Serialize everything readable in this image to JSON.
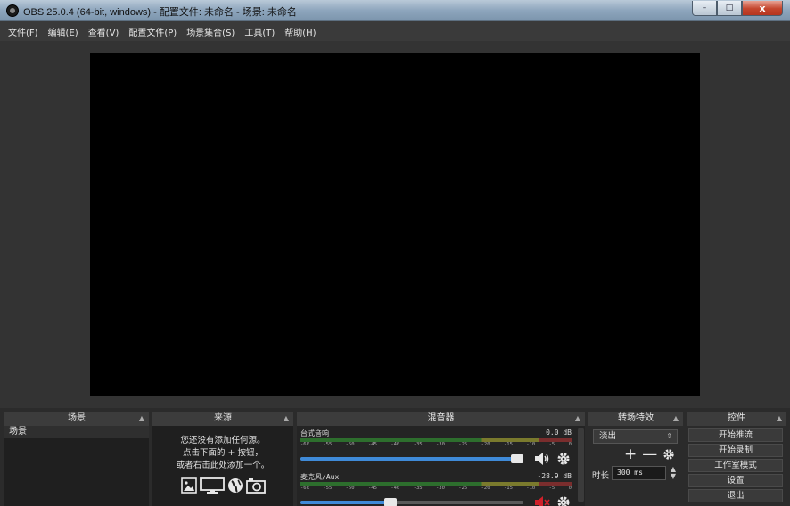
{
  "window": {
    "title": "OBS 25.0.4 (64-bit, windows) - 配置文件: 未命名 - 场景: 未命名",
    "minimize_glyph": "–",
    "maximize_glyph": "□",
    "close_glyph": "x"
  },
  "menu": {
    "items": [
      "文件(F)",
      "编辑(E)",
      "查看(V)",
      "配置文件(P)",
      "场景集合(S)",
      "工具(T)",
      "帮助(H)"
    ]
  },
  "docks": {
    "scenes": {
      "title": "场景",
      "items": [
        "场景"
      ]
    },
    "sources": {
      "title": "来源",
      "empty_lines": [
        "您还没有添加任何源。",
        "点击下面的 + 按钮，",
        "或者右击此处添加一个。"
      ],
      "icons": [
        "image-icon",
        "monitor-icon",
        "globe-icon",
        "camera-icon"
      ]
    },
    "mixer": {
      "title": "混音器",
      "channels": [
        {
          "name": "台式音响",
          "db": "0.0 dB",
          "volume": 1.0,
          "muted": false
        },
        {
          "name": "麦克风/Aux",
          "db": "-28.9 dB",
          "volume": 0.4,
          "muted": true
        }
      ],
      "scale": [
        "-60",
        "-55",
        "-50",
        "-45",
        "-40",
        "-35",
        "-30",
        "-25",
        "-20",
        "-15",
        "-10",
        "-5",
        "0"
      ]
    },
    "transitions": {
      "title": "转场特效",
      "selected": "淡出",
      "add_glyph": "+",
      "remove_glyph": "—",
      "duration_label": "时长",
      "duration_value": "300 ms"
    },
    "controls": {
      "title": "控件",
      "buttons": [
        "开始推流",
        "开始录制",
        "工作室模式",
        "设置",
        "退出"
      ]
    }
  },
  "colors": {
    "meter_green": "#2d6e2d",
    "volume_blue": "#3f8ad8",
    "muted_red": "#d0202a",
    "close_red": "#c4452d"
  }
}
